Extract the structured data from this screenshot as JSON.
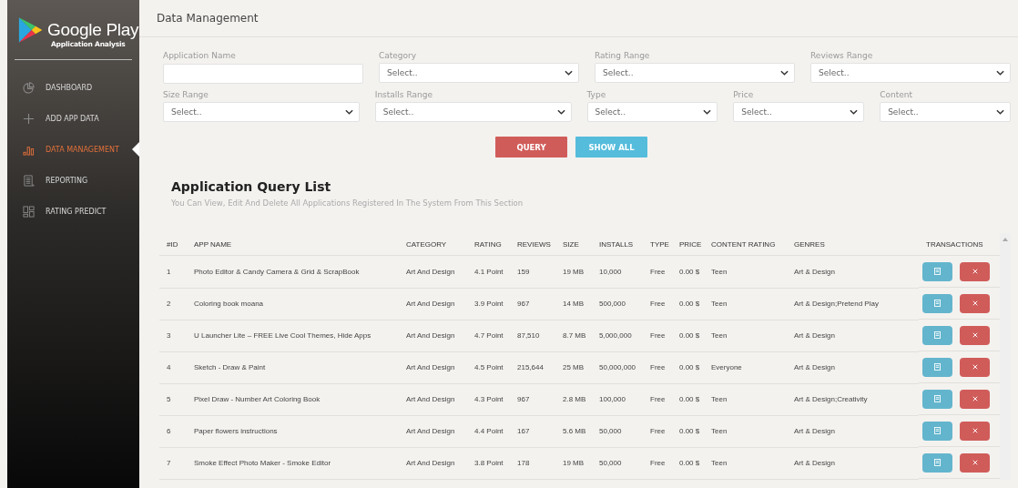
{
  "brand": {
    "name": "Google Play",
    "subtitle": "Application Analysis"
  },
  "sidebar": {
    "items": [
      {
        "label": "DASHBOARD",
        "kind": "pie",
        "selected": false
      },
      {
        "label": "ADD APP DATA",
        "kind": "plus",
        "selected": false
      },
      {
        "label": "DATA MANAGEMENT",
        "kind": "bars",
        "selected": true
      },
      {
        "label": "REPORTING",
        "kind": "doc",
        "selected": false
      },
      {
        "label": "RATING PREDICT",
        "kind": "grid",
        "selected": false
      }
    ]
  },
  "header": {
    "title": "Data Management"
  },
  "filters": {
    "rows": [
      [
        {
          "label": "Application Name",
          "kind": "text"
        },
        {
          "label": "Category",
          "kind": "select",
          "value": "Select.."
        },
        {
          "label": "Rating Range",
          "kind": "select",
          "value": "Select.."
        },
        {
          "label": "Reviews Range",
          "kind": "select",
          "value": "Select.."
        }
      ],
      [
        {
          "label": "Size Range",
          "kind": "select",
          "value": "Select.."
        },
        {
          "label": "Installs Range",
          "kind": "select",
          "value": "Select.."
        },
        {
          "label": "Type",
          "kind": "select",
          "value": "Select.."
        },
        {
          "label": "Price",
          "kind": "select",
          "value": "Select.."
        },
        {
          "label": "Content",
          "kind": "select",
          "value": "Select.."
        }
      ]
    ],
    "buttons": [
      {
        "label": "QUERY",
        "kind": "danger"
      },
      {
        "label": "SHOW ALL",
        "kind": "info"
      }
    ]
  },
  "list": {
    "title": "Application Query List",
    "subtitle": "You Can View, Edit And Delete All Applications Registered In The System From This Section"
  },
  "table": {
    "columns": [
      "#ID",
      "APP NAME",
      "CATEGORY",
      "RATING",
      "REVIEWS",
      "SIZE",
      "INSTALLS",
      "TYPE",
      "PRICE",
      "CONTENT RATING",
      "GENRES",
      "TRANSACTIONS"
    ],
    "rows": [
      [
        "1",
        "Photo Editor & Candy Camera & Grid & ScrapBook",
        "Art And Design",
        "4.1 Point",
        "159",
        "19 MB",
        "10,000",
        "Free",
        "0.00 $",
        "Teen",
        "Art & Design"
      ],
      [
        "2",
        "Coloring book moana",
        "Art And Design",
        "3.9 Point",
        "967",
        "14 MB",
        "500,000",
        "Free",
        "0.00 $",
        "Teen",
        "Art & Design;Pretend Play"
      ],
      [
        "3",
        "U Launcher Lite – FREE Live Cool Themes, Hide Apps",
        "Art And Design",
        "4.7 Point",
        "87,510",
        "8.7 MB",
        "5,000,000",
        "Free",
        "0.00 $",
        "Teen",
        "Art & Design"
      ],
      [
        "4",
        "Sketch - Draw & Paint",
        "Art And Design",
        "4.5 Point",
        "215,644",
        "25 MB",
        "50,000,000",
        "Free",
        "0.00 $",
        "Everyone",
        "Art & Design"
      ],
      [
        "5",
        "Pixel Draw - Number Art Coloring Book",
        "Art And Design",
        "4.3 Point",
        "967",
        "2.8 MB",
        "100,000",
        "Free",
        "0.00 $",
        "Teen",
        "Art & Design;Creativity"
      ],
      [
        "6",
        "Paper flowers instructions",
        "Art And Design",
        "4.4 Point",
        "167",
        "5.6 MB",
        "50,000",
        "Free",
        "0.00 $",
        "Teen",
        "Art & Design"
      ],
      [
        "7",
        "Smoke Effect Photo Maker - Smoke Editor",
        "Art And Design",
        "3.8 Point",
        "178",
        "19 MB",
        "50,000",
        "Free",
        "0.00 $",
        "Teen",
        "Art & Design"
      ]
    ]
  }
}
